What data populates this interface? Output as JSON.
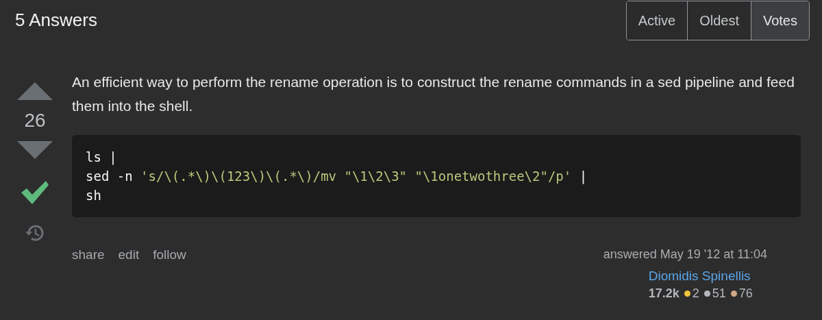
{
  "header": {
    "title": "5 Answers",
    "sort_tabs": [
      {
        "label": "Active",
        "selected": false
      },
      {
        "label": "Oldest",
        "selected": false
      },
      {
        "label": "Votes",
        "selected": true
      }
    ]
  },
  "answer": {
    "votes": "26",
    "accepted": true,
    "text": "An efficient way to perform the rename operation is to construct the rename commands in a sed pipeline and feed them into the shell.",
    "code": [
      [
        {
          "kind": "plain",
          "text": "ls |"
        }
      ],
      [
        {
          "kind": "plain",
          "text": "sed -n "
        },
        {
          "kind": "string",
          "text": "'s/\\(.*\\)\\(123\\)\\(.*\\)/mv \"\\1\\2\\3\" \"\\1onetwothree\\2\"/p'"
        },
        {
          "kind": "plain",
          "text": " |"
        }
      ],
      [
        {
          "kind": "plain",
          "text": "sh"
        }
      ]
    ],
    "actions": [
      "share",
      "edit",
      "follow"
    ],
    "signature": {
      "answered": "answered May 19 '12 at 11:04",
      "user": "Diomidis Spinellis",
      "reputation": "17.2k",
      "badges": [
        {
          "count": "2",
          "color": "#f1c53b"
        },
        {
          "count": "51",
          "color": "#b4b8bc"
        },
        {
          "count": "76",
          "color": "#cfa986"
        }
      ]
    }
  }
}
